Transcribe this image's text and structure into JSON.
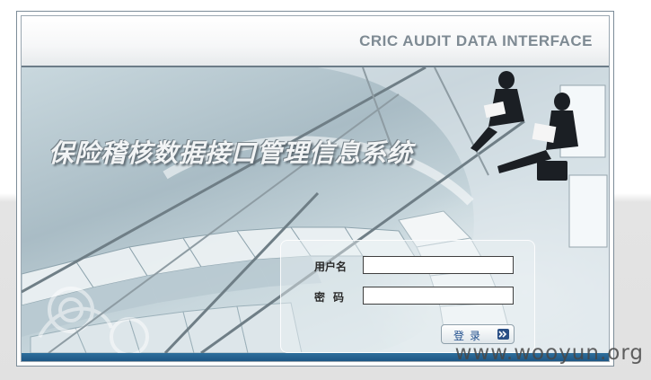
{
  "header": {
    "title": "CRIC AUDIT DATA INTERFACE"
  },
  "hero": {
    "system_title": "保险稽核数据接口管理信息系统"
  },
  "login": {
    "username_label": "用户名",
    "password_label": "密码",
    "username_value": "",
    "password_value": "",
    "submit_label": "登录",
    "submit_icon": "double-chevron-right-icon"
  },
  "watermark": {
    "text": "www.wooyun.org"
  },
  "colors": {
    "header_title": "#7e8a93",
    "footer_bar": "#1d5684",
    "button_text": "#1f4e8c"
  }
}
